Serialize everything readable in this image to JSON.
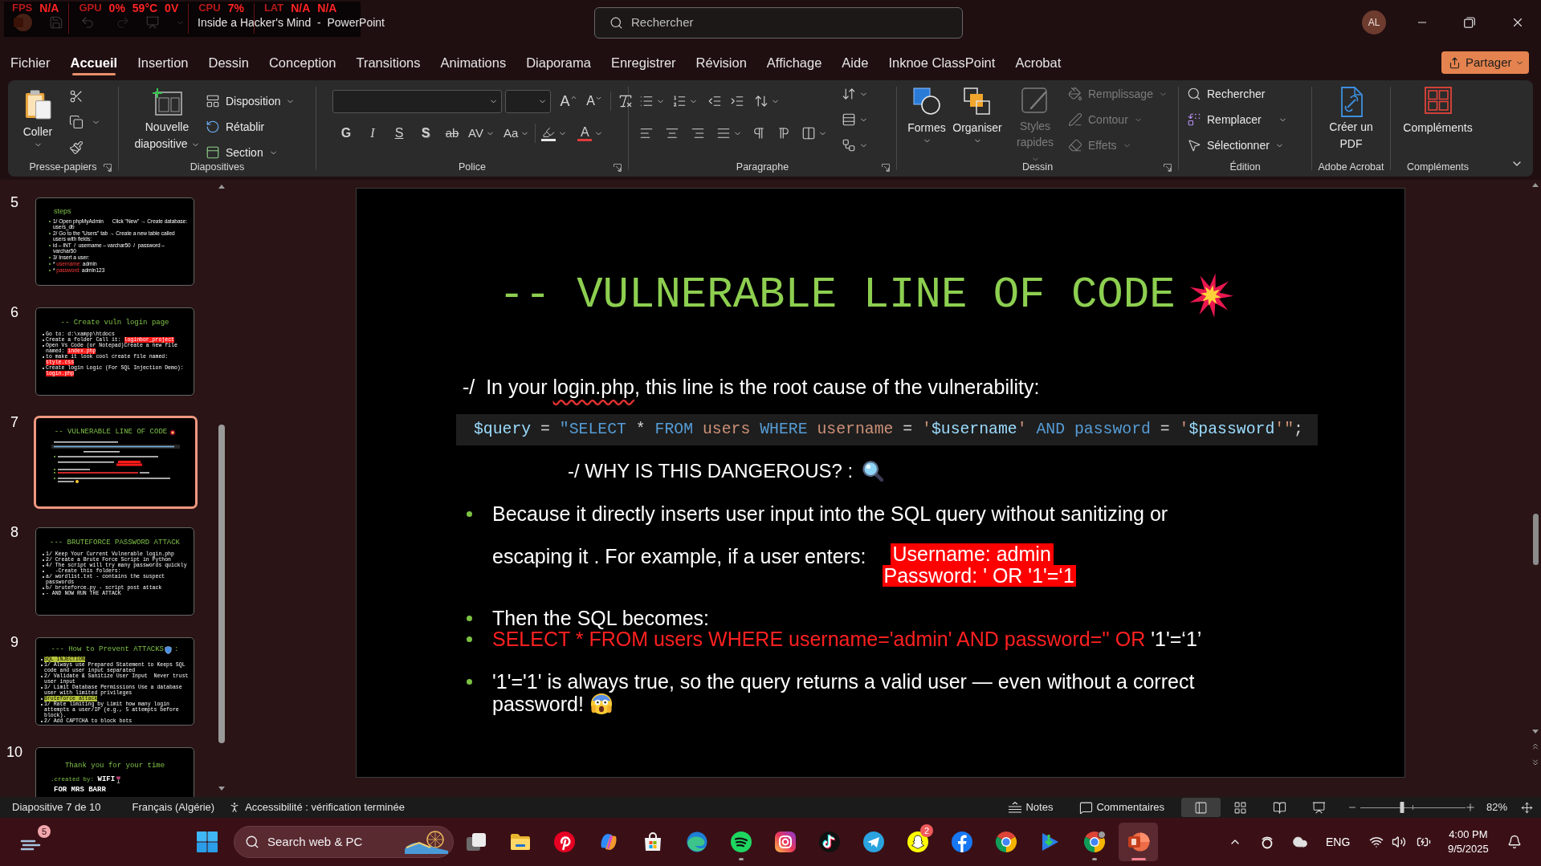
{
  "title_bar": {
    "title": "Inside a Hacker's Mind  -  PowerPoint",
    "search": {
      "placeholder": "Rechercher"
    },
    "avatar": "AL"
  },
  "perf_overlay": [
    {
      "label": "FPS",
      "values": [
        "N/A"
      ]
    },
    {
      "label": "GPU",
      "values": [
        "0%",
        "59°C",
        "0V"
      ]
    },
    {
      "label": "CPU",
      "values": [
        "7%"
      ]
    },
    {
      "label": "LAT",
      "values": [
        "N/A",
        "N/A"
      ]
    }
  ],
  "menu": {
    "tabs": [
      {
        "label": "Fichier",
        "selected": false
      },
      {
        "label": "Accueil",
        "selected": true
      },
      {
        "label": "Insertion",
        "selected": false
      },
      {
        "label": "Dessin",
        "selected": false
      },
      {
        "label": "Conception",
        "selected": false
      },
      {
        "label": "Transitions",
        "selected": false
      },
      {
        "label": "Animations",
        "selected": false
      },
      {
        "label": "Diaporama",
        "selected": false
      },
      {
        "label": "Enregistrer",
        "selected": false
      },
      {
        "label": "Révision",
        "selected": false
      },
      {
        "label": "Affichage",
        "selected": false
      },
      {
        "label": "Aide",
        "selected": false
      },
      {
        "label": "Inknoe ClassPoint",
        "selected": false
      },
      {
        "label": "Acrobat",
        "selected": false
      }
    ],
    "share": "Partager"
  },
  "ribbon": {
    "clipboard": {
      "label": "Presse-papiers",
      "paste": "Coller"
    },
    "slides": {
      "label": "Diapositives",
      "new_slide": "Nouvelle diapositive",
      "layout": "Disposition",
      "reset": "Rétablir",
      "section": "Section"
    },
    "font": {
      "label": "Police",
      "grow": "A",
      "shrink": "A",
      "bold": "G",
      "italic": "I",
      "underline": "S",
      "shadow": "S",
      "strike": "ab",
      "spacing": "AV",
      "case": "Aa",
      "font_color": "A"
    },
    "paragraph": {
      "label": "Paragraphe"
    },
    "drawing": {
      "label": "Dessin",
      "shapes": "Formes",
      "arrange": "Organiser",
      "quick_styles": {
        "label": "Styles rapides",
        "disabled": true
      },
      "fill": {
        "label": "Remplissage",
        "disabled": true
      },
      "outline": {
        "label": "Contour",
        "disabled": true
      },
      "effects": {
        "label": "Effets",
        "disabled": true
      }
    },
    "editing": {
      "label": "Édition",
      "find": "Rechercher",
      "replace": "Remplacer",
      "select": "Sélectionner"
    },
    "acrobat": {
      "label": "Adobe Acrobat",
      "create_pdf": "Créer un PDF"
    },
    "addins": {
      "label": "Compléments",
      "button": "Compléments"
    }
  },
  "thumbnails": [
    {
      "number": "5",
      "kind": "steps",
      "selected": false,
      "title": "steps",
      "lines": [
        {
          "segments": [
            {
              "text": "1/ Open phpMyAdmin      Click \"New\" → Create database: users_db",
              "kind": "plain"
            }
          ]
        },
        {
          "segments": [
            {
              "text": "2/ Go to the \"Users\" tab → Create a new table called users with fields:",
              "kind": "plain"
            }
          ]
        },
        {
          "segments": [
            {
              "text": "id – INT  /  username – varchar50  /  password – varchar50",
              "kind": "plain"
            }
          ]
        },
        {
          "segments": [
            {
              "text": "3/ Insert a user:",
              "kind": "plain"
            }
          ]
        },
        {
          "segments": [
            {
              "text": "* ",
              "kind": "plain"
            },
            {
              "text": "username:",
              "kind": "red_text"
            },
            {
              "text": " admin",
              "kind": "plain"
            }
          ]
        },
        {
          "segments": [
            {
              "text": "* ",
              "kind": "plain"
            },
            {
              "text": "password:",
              "kind": "red_text"
            },
            {
              "text": " admin123",
              "kind": "plain"
            }
          ]
        }
      ]
    },
    {
      "number": "6",
      "kind": "list",
      "selected": false,
      "title": "-- Create vuln login page",
      "lines": [
        {
          "segments": [
            {
              "text": "Go to: d:\\xampp\\htdocs",
              "kind": "plain"
            }
          ]
        },
        {
          "segments": [
            {
              "text": "Create a folder Call it: ",
              "kind": "plain"
            },
            {
              "text": "loginbor_project",
              "kind": "red_mark"
            }
          ]
        },
        {
          "segments": [
            {
              "text": "Open Vs Code (or Notepad)Create a new file named: ",
              "kind": "plain"
            },
            {
              "text": "index.php",
              "kind": "red_mark"
            }
          ]
        },
        {
          "segments": [
            {
              "text": "to make it look cool create file named: ",
              "kind": "plain"
            },
            {
              "text": "style.css",
              "kind": "red_mark"
            }
          ]
        },
        {
          "segments": [
            {
              "text": "Create login Logic (For SQL Injection Demo): ",
              "kind": "plain"
            },
            {
              "text": "login.php",
              "kind": "red_mark"
            }
          ]
        }
      ]
    },
    {
      "number": "7",
      "kind": "preview",
      "selected": true,
      "title": "-- VULNERABLE LINE OF CODE"
    },
    {
      "number": "8",
      "kind": "list",
      "selected": false,
      "title": "--- BRUTEFORCE PASSWORD ATTACK",
      "lines": [
        {
          "segments": [
            {
              "text": "1/ Keep Your Current Vulnerable login.php",
              "kind": "plain"
            }
          ]
        },
        {
          "segments": [
            {
              "text": "2/ Create a Brute Force Script in Python",
              "kind": "plain"
            }
          ]
        },
        {
          "segments": [
            {
              "text": "4/ The script will try many passwords quickly",
              "kind": "plain"
            }
          ]
        },
        {
          "segments": [
            {
              "text": "   -Create this folders:",
              "kind": "plain"
            }
          ]
        },
        {
          "segments": [
            {
              "text": "a/ wordlist.txt - contains the suspect passwords",
              "kind": "plain"
            }
          ]
        },
        {
          "segments": [
            {
              "text": "b/ bruteforce.py - script post attack",
              "kind": "plain"
            }
          ]
        },
        {
          "segments": [
            {
              "text": "- AND NOW RUN THE ATTACK",
              "kind": "plain"
            }
          ]
        }
      ]
    },
    {
      "number": "9",
      "kind": "defense",
      "selected": false,
      "title": "--- How to Prevent ATTACKS",
      "title_end": ":",
      "lines": [
        {
          "segments": [
            {
              "text": "SQL INJECTION",
              "kind": "lime_mark"
            }
          ]
        },
        {
          "segments": [
            {
              "text": "1/ Always use Prepared Statement to Keeps SQL code and user input separated",
              "kind": "plain"
            }
          ]
        },
        {
          "segments": [
            {
              "text": "2/ Validate & Sanitize User Input  Never trust user input",
              "kind": "plain"
            }
          ]
        },
        {
          "segments": [
            {
              "text": "3/ Limit Database Permissions Use a database user with limited privileges",
              "kind": "plain"
            }
          ]
        },
        {
          "segments": [
            {
              "text": "Bruteforce attack",
              "kind": "lime_mark"
            }
          ]
        },
        {
          "segments": [
            {
              "text": "1/ Rate limiting by Limit how many login attempts a user/IP (e.g., 5 attempts before block).",
              "kind": "plain"
            }
          ]
        },
        {
          "segments": [
            {
              "text": "2/ Add CAPTCHA to block bots",
              "kind": "plain"
            }
          ]
        }
      ]
    },
    {
      "number": "10",
      "kind": "closing",
      "selected": false,
      "title": "Thank you for your time",
      "lines": [
        {
          "segments": [
            {
              "text": ".created by: ",
              "kind": "green_small"
            },
            {
              "text": "WIFI",
              "kind": "large"
            }
          ]
        },
        {
          "segments": [
            {
              "text": "FOR MRS BARR",
              "kind": "large"
            }
          ]
        }
      ]
    }
  ],
  "slide": {
    "title": "-- VULNERABLE LINE OF CODE",
    "intro": [
      {
        "text": "-/  In your ",
        "kind": "plain"
      },
      {
        "text": "login.php",
        "kind": "flagged"
      },
      {
        "text": ", this line is the root cause of the vulnerability:",
        "kind": "plain"
      }
    ],
    "code": [
      {
        "text": "$query",
        "kind": "variable"
      },
      {
        "text": " = ",
        "kind": "plain"
      },
      {
        "text": "\"SELECT",
        "kind": "keyword"
      },
      {
        "text": " * ",
        "kind": "plain"
      },
      {
        "text": "FROM",
        "kind": "keyword"
      },
      {
        "text": " users ",
        "kind": "string"
      },
      {
        "text": "WHERE",
        "kind": "keyword"
      },
      {
        "text": " username ",
        "kind": "string"
      },
      {
        "text": "= ",
        "kind": "plain"
      },
      {
        "text": "'",
        "kind": "string"
      },
      {
        "text": "$username",
        "kind": "variable"
      },
      {
        "text": "'",
        "kind": "string"
      },
      {
        "text": " AND ",
        "kind": "keyword"
      },
      {
        "text": "password",
        "kind": "keyword"
      },
      {
        "text": " = ",
        "kind": "plain"
      },
      {
        "text": "'",
        "kind": "string"
      },
      {
        "text": "$password",
        "kind": "variable"
      },
      {
        "text": "'\"",
        "kind": "string"
      },
      {
        "text": ";",
        "kind": "plain"
      }
    ],
    "subheading": "-/ WHY IS THIS DANGEROUS? :",
    "bullets": [
      {
        "kind": "example",
        "text": "Because it directly inserts user input into the SQL query without sanitizing or escaping it . For example, if a user enters:",
        "highlights": [
          "Username: admin",
          "Password: ' OR '1'=‘1"
        ]
      },
      {
        "kind": "text",
        "segments": [
          {
            "text": "Then the SQL becomes:",
            "kind": "plain"
          }
        ]
      },
      {
        "kind": "text",
        "segments": [
          {
            "text": "SELECT * FROM users WHERE username='admin' AND password='' OR ",
            "kind": "red"
          },
          {
            "text": "'1'=‘1’",
            "kind": "plain"
          }
        ]
      },
      {
        "kind": "closing",
        "lines": [
          "'1'='1' is always true, so the query returns a valid user — even without a correct",
          "password!"
        ]
      }
    ]
  },
  "status_bar": {
    "slide": "Diapositive 7 de 10",
    "language": "Français (Algérie)",
    "accessibility": "Accessibilité : vérification terminée",
    "notes": "Notes",
    "comments": "Commentaires",
    "views": [
      {
        "kind": "normal",
        "selected": true
      },
      {
        "kind": "sorter",
        "selected": false
      },
      {
        "kind": "reading",
        "selected": false
      },
      {
        "kind": "slideshow",
        "selected": false
      }
    ],
    "zoom": {
      "level": 0.4,
      "reading": "82%"
    }
  },
  "taskbar": {
    "widget_badge": "5",
    "search": {
      "placeholder": "Search web & PC"
    },
    "apps": [
      {
        "kind": "task_view",
        "running": false,
        "selected": false
      },
      {
        "kind": "explorer",
        "running": false,
        "selected": false
      },
      {
        "kind": "pinterest",
        "running": false,
        "selected": false
      },
      {
        "kind": "copilot",
        "running": false,
        "selected": false
      },
      {
        "kind": "store",
        "running": false,
        "selected": false
      },
      {
        "kind": "edge",
        "running": false,
        "selected": false
      },
      {
        "kind": "spotify",
        "running": true,
        "selected": false
      },
      {
        "kind": "instagram",
        "running": false,
        "selected": false
      },
      {
        "kind": "tiktok",
        "running": false,
        "selected": false
      },
      {
        "kind": "telegram",
        "running": false,
        "selected": false
      },
      {
        "kind": "snapchat",
        "running": false,
        "selected": false,
        "badge": "2"
      },
      {
        "kind": "facebook",
        "running": false,
        "selected": false
      },
      {
        "kind": "chrome",
        "running": false,
        "selected": false
      },
      {
        "kind": "play",
        "running": false,
        "selected": false
      },
      {
        "kind": "chrome_profile",
        "running": true,
        "selected": false
      },
      {
        "kind": "powerpoint",
        "running": true,
        "selected": true
      }
    ],
    "tray": {
      "language": "ENG",
      "time": "4:00 PM",
      "date": "9/5/2025"
    }
  }
}
